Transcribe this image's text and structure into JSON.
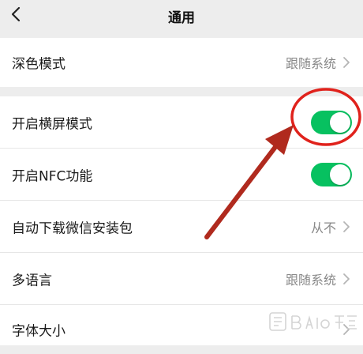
{
  "nav": {
    "title": "通用"
  },
  "dark_mode": {
    "label": "深色模式",
    "value": "跟随系统"
  },
  "settings": {
    "landscape": {
      "label": "开启横屏模式",
      "enabled": true
    },
    "nfc": {
      "label": "开启NFC功能",
      "enabled": true
    },
    "auto_download": {
      "label": "自动下载微信安装包",
      "value": "从不"
    },
    "language": {
      "label": "多语言",
      "value": "跟随系统"
    },
    "font_size": {
      "label": "字体大小"
    }
  },
  "colors": {
    "toggle_on": "#07c160",
    "annotation": "#e0221c",
    "arrow": "#b02a1e"
  }
}
